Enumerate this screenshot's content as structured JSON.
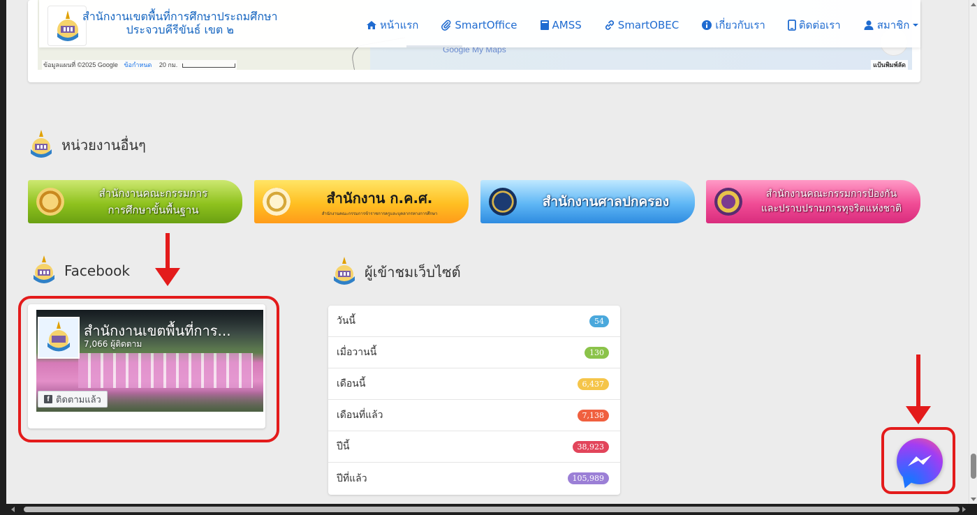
{
  "navbar": {
    "brand_line1": "สำนักงานเขตพื้นที่การศึกษาประถมศึกษา",
    "brand_line2": "ประจวบคีรีขันธ์ เขต ๒",
    "items": [
      {
        "label": "หน้าแรก",
        "icon": "home-icon"
      },
      {
        "label": "SmartOffice",
        "icon": "paperclip-icon"
      },
      {
        "label": "AMSS",
        "icon": "book-icon"
      },
      {
        "label": "SmartOBEC",
        "icon": "link-icon"
      },
      {
        "label": "เกี่ยวกับเรา",
        "icon": "info-icon"
      },
      {
        "label": "ติดต่อเรา",
        "icon": "phone-icon"
      },
      {
        "label": "สมาชิก",
        "icon": "user-icon"
      }
    ]
  },
  "map": {
    "attribution": "ข้อมูลแผนที่ ©2025 Google",
    "terms": "ข้อกำหนด",
    "scale": "20 กม.",
    "brand": "Google My Maps",
    "shortcuts": "แป้นพิมพ์ลัด"
  },
  "agencies": {
    "title": "หน่วยงานอื่นๆ",
    "banners": [
      {
        "line1": "สำนักงานคณะกรรมการ",
        "line2": "การศึกษาขั้นพื้นฐาน"
      },
      {
        "line1": "สำนักงาน ก.ค.ศ.",
        "line2": "สำนักงานคณะกรรมการข้าราชการครูและบุคลากรทางการศึกษา"
      },
      {
        "line1": "สำนักงานศาลปกครอง"
      },
      {
        "line1": "สำนักงานคณะกรรมการป้องกัน",
        "line2": "และปราบปรามการทุจริตแห่งชาติ"
      }
    ]
  },
  "facebook": {
    "title": "Facebook",
    "page_name": "สำนักงานเขตพื้นที่การ...",
    "followers": "7,066 ผู้ติดตาม",
    "follow_button": "ติดตามแล้ว"
  },
  "visitors": {
    "title": "ผู้เข้าชมเว็บไซต์",
    "rows": [
      {
        "label": "วันนี้",
        "value": "54",
        "color": "#4aa8dc"
      },
      {
        "label": "เมื่อวานนี้",
        "value": "130",
        "color": "#8bc34a"
      },
      {
        "label": "เดือนนี้",
        "value": "6,437",
        "color": "#f5c54a"
      },
      {
        "label": "เดือนที่แล้ว",
        "value": "7,138",
        "color": "#f0603f"
      },
      {
        "label": "ปีนี้",
        "value": "38,923",
        "color": "#e2455b"
      },
      {
        "label": "ปีที่แล้ว",
        "value": "105,989",
        "color": "#9b7fd6"
      }
    ]
  },
  "colors": {
    "accent": "#1f6bd0",
    "annotation": "#e31b1b"
  }
}
